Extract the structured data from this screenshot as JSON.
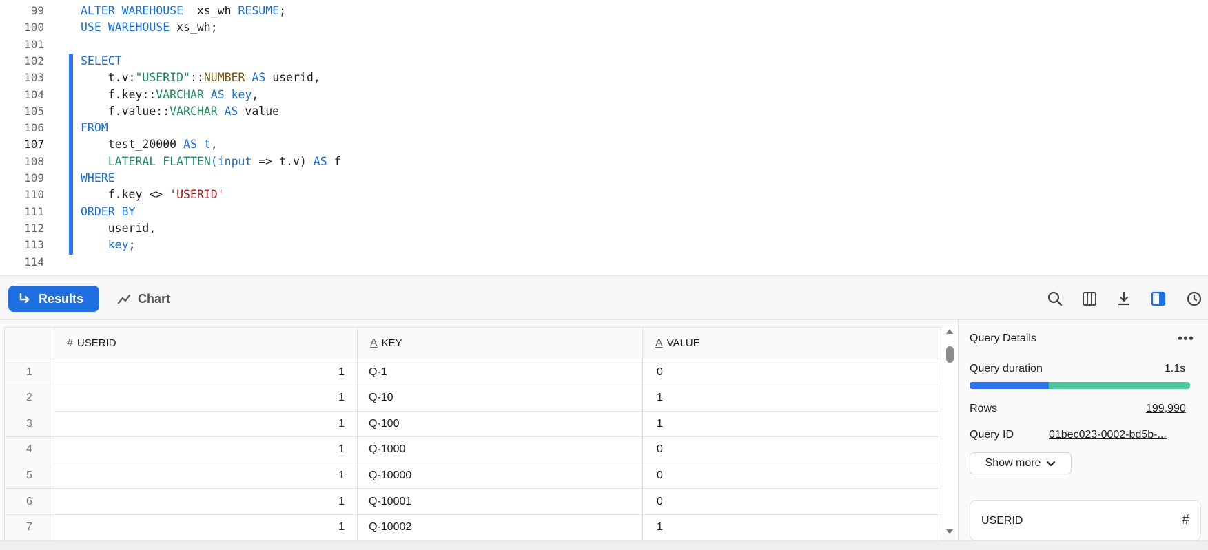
{
  "editor": {
    "lines": [
      {
        "n": "99",
        "tokens": [
          [
            "kw",
            "ALTER WAREHOUSE"
          ],
          [
            "",
            "  xs_wh "
          ],
          [
            "kw",
            "RESUME"
          ],
          [
            "",
            ";"
          ]
        ]
      },
      {
        "n": "100",
        "tokens": [
          [
            "kw",
            "USE WAREHOUSE"
          ],
          [
            "",
            " xs_wh;"
          ]
        ]
      },
      {
        "n": "101",
        "tokens": []
      },
      {
        "n": "102",
        "tokens": [
          [
            "kw",
            "SELECT"
          ]
        ]
      },
      {
        "n": "103",
        "tokens": [
          [
            "",
            "    t.v:"
          ],
          [
            "strg",
            "\"USERID\""
          ],
          [
            "",
            "::"
          ],
          [
            "tyb",
            "NUMBER"
          ],
          [
            "",
            " "
          ],
          [
            "kw",
            "AS"
          ],
          [
            "",
            " userid,"
          ]
        ]
      },
      {
        "n": "104",
        "tokens": [
          [
            "",
            "    f.key::"
          ],
          [
            "ty",
            "VARCHAR"
          ],
          [
            "",
            " "
          ],
          [
            "kw",
            "AS"
          ],
          [
            "",
            " "
          ],
          [
            "lk",
            "key"
          ],
          [
            "",
            ","
          ]
        ]
      },
      {
        "n": "105",
        "tokens": [
          [
            "",
            "    f.value::"
          ],
          [
            "ty",
            "VARCHAR"
          ],
          [
            "",
            " "
          ],
          [
            "kw",
            "AS"
          ],
          [
            "",
            " value"
          ]
        ]
      },
      {
        "n": "106",
        "tokens": [
          [
            "kw",
            "FROM"
          ]
        ]
      },
      {
        "n": "107",
        "tokens": [
          [
            "",
            "    test_20000 "
          ],
          [
            "kw",
            "AS"
          ],
          [
            "",
            " "
          ],
          [
            "lk",
            "t"
          ],
          [
            "",
            ","
          ]
        ],
        "active": true
      },
      {
        "n": "108",
        "tokens": [
          [
            "",
            "    "
          ],
          [
            "fn",
            "LATERAL FLATTEN"
          ],
          [
            "lk",
            "("
          ],
          [
            "kw",
            "input"
          ],
          [
            "",
            " => t.v) "
          ],
          [
            "kw",
            "AS"
          ],
          [
            "",
            " f"
          ]
        ]
      },
      {
        "n": "109",
        "tokens": [
          [
            "kw",
            "WHERE"
          ]
        ]
      },
      {
        "n": "110",
        "tokens": [
          [
            "",
            "    f.key <> "
          ],
          [
            "str",
            "'USERID'"
          ]
        ]
      },
      {
        "n": "111",
        "tokens": [
          [
            "kw",
            "ORDER BY"
          ]
        ]
      },
      {
        "n": "112",
        "tokens": [
          [
            "",
            "    userid,"
          ]
        ]
      },
      {
        "n": "113",
        "tokens": [
          [
            "",
            "    "
          ],
          [
            "lk",
            "key"
          ],
          [
            "",
            ";"
          ]
        ]
      },
      {
        "n": "114",
        "tokens": []
      }
    ]
  },
  "toolbar": {
    "results_label": "Results",
    "chart_label": "Chart",
    "icons": [
      "search-icon",
      "columns-icon",
      "download-icon",
      "split-panel-icon",
      "history-icon"
    ]
  },
  "grid": {
    "columns": [
      {
        "name": "USERID",
        "type_icon": "#"
      },
      {
        "name": "KEY",
        "type_icon": "A"
      },
      {
        "name": "VALUE",
        "type_icon": "A"
      }
    ],
    "rows": [
      [
        "1",
        "1",
        "Q-1",
        "0"
      ],
      [
        "2",
        "1",
        "Q-10",
        "1"
      ],
      [
        "3",
        "1",
        "Q-100",
        "1"
      ],
      [
        "4",
        "1",
        "Q-1000",
        "0"
      ],
      [
        "5",
        "1",
        "Q-10000",
        "0"
      ],
      [
        "6",
        "1",
        "Q-10001",
        "0"
      ],
      [
        "7",
        "1",
        "Q-10002",
        "1"
      ]
    ]
  },
  "details": {
    "title": "Query Details",
    "duration_label": "Query duration",
    "duration_value": "1.1s",
    "duration_fraction": 0.36,
    "rows_label": "Rows",
    "rows_value": "199,990",
    "query_id_label": "Query ID",
    "query_id_value": "01bec023-0002-bd5b-...",
    "show_more_label": "Show more",
    "column_card_label": "USERID",
    "colors": {
      "blue": "#2f72f0",
      "green": "#4ec79a"
    }
  }
}
